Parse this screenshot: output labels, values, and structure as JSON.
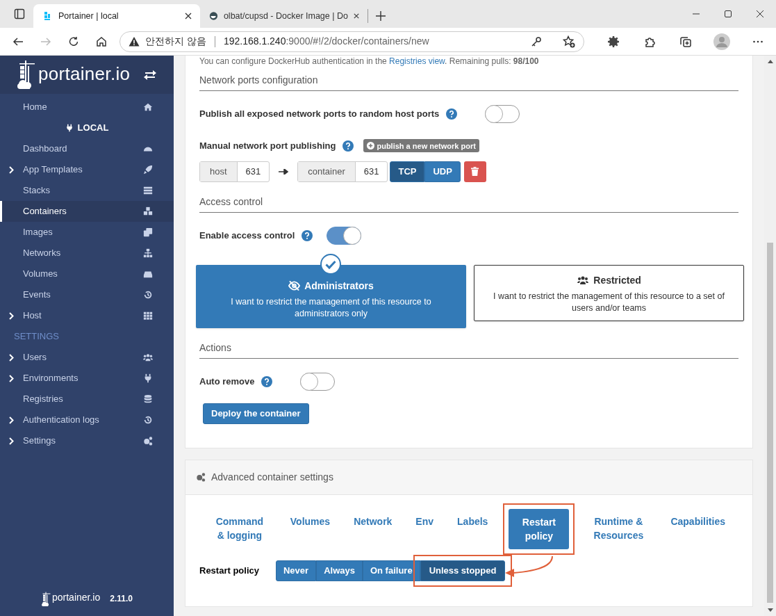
{
  "browser": {
    "tabs": [
      {
        "title": "Portainer | local",
        "selected": true
      },
      {
        "title": "olbat/cupsd - Docker Image | Do",
        "selected": false
      }
    ],
    "address": {
      "security": "안전하지 않음",
      "host": "192.168.1.240",
      "rest": ":9000/#!/2/docker/containers/new"
    }
  },
  "sidebar": {
    "logo": "portainer.io",
    "items": [
      {
        "label": "Home",
        "kind": "item",
        "selected": false,
        "expandable": false
      },
      {
        "label": "LOCAL",
        "kind": "endpoint"
      },
      {
        "label": "Dashboard",
        "kind": "item",
        "selected": false,
        "expandable": false
      },
      {
        "label": "App Templates",
        "kind": "item",
        "selected": false,
        "expandable": true
      },
      {
        "label": "Stacks",
        "kind": "item",
        "selected": false,
        "expandable": false
      },
      {
        "label": "Containers",
        "kind": "item",
        "selected": true,
        "expandable": false
      },
      {
        "label": "Images",
        "kind": "item",
        "selected": false,
        "expandable": false
      },
      {
        "label": "Networks",
        "kind": "item",
        "selected": false,
        "expandable": false
      },
      {
        "label": "Volumes",
        "kind": "item",
        "selected": false,
        "expandable": false
      },
      {
        "label": "Events",
        "kind": "item",
        "selected": false,
        "expandable": false
      },
      {
        "label": "Host",
        "kind": "item",
        "selected": false,
        "expandable": true
      },
      {
        "label": "SETTINGS",
        "kind": "section"
      },
      {
        "label": "Users",
        "kind": "item",
        "selected": false,
        "expandable": true
      },
      {
        "label": "Environments",
        "kind": "item",
        "selected": false,
        "expandable": true
      },
      {
        "label": "Registries",
        "kind": "item",
        "selected": false,
        "expandable": false
      },
      {
        "label": "Authentication logs",
        "kind": "item",
        "selected": false,
        "expandable": true
      },
      {
        "label": "Settings",
        "kind": "item",
        "selected": false,
        "expandable": true
      }
    ],
    "footer_logo": "portainer.io",
    "version": "2.11.0"
  },
  "notice": {
    "before": "You can configure DockerHub authentication in the ",
    "link": "Registries view",
    "after": ". Remaining pulls: **98/100**"
  },
  "network_ports": {
    "title": "Network ports configuration",
    "publish_all": {
      "label": "Publish all exposed network ports to random host ports",
      "on": false
    },
    "manual": {
      "label": "Manual network port publishing",
      "button": "publish a new network port"
    },
    "mapping": {
      "host_label": "host",
      "host_value": "631",
      "container_label": "container",
      "container_value": "631",
      "protocols": [
        {
          "label": "TCP",
          "selected": true
        },
        {
          "label": "UDP",
          "selected": false
        }
      ]
    }
  },
  "access_control": {
    "title": "Access control",
    "enable": {
      "label": "Enable access control",
      "on": true
    },
    "options": [
      {
        "title": "Administrators",
        "description": "I want to restrict the management of this resource to administrators only",
        "selected": true
      },
      {
        "title": "Restricted",
        "description": "I want to restrict the management of this resource to a set of users and/or teams",
        "selected": false
      }
    ]
  },
  "actions": {
    "title": "Actions",
    "auto_remove": {
      "label": "Auto remove",
      "on": false
    },
    "deploy": "Deploy the container"
  },
  "advanced": {
    "title": "Advanced container settings",
    "tabs": [
      {
        "label": "Command & logging",
        "selected": false
      },
      {
        "label": "Volumes",
        "selected": false
      },
      {
        "label": "Network",
        "selected": false
      },
      {
        "label": "Env",
        "selected": false
      },
      {
        "label": "Labels",
        "selected": false
      },
      {
        "label": "Restart policy",
        "selected": true
      },
      {
        "label": "Runtime & Resources",
        "selected": false
      },
      {
        "label": "Capabilities",
        "selected": false
      }
    ],
    "restart_policy": {
      "label": "Restart policy",
      "options": [
        {
          "label": "Never",
          "selected": false
        },
        {
          "label": "Always",
          "selected": false
        },
        {
          "label": "On failure",
          "selected": false
        },
        {
          "label": "Unless stopped",
          "selected": true
        }
      ]
    }
  }
}
